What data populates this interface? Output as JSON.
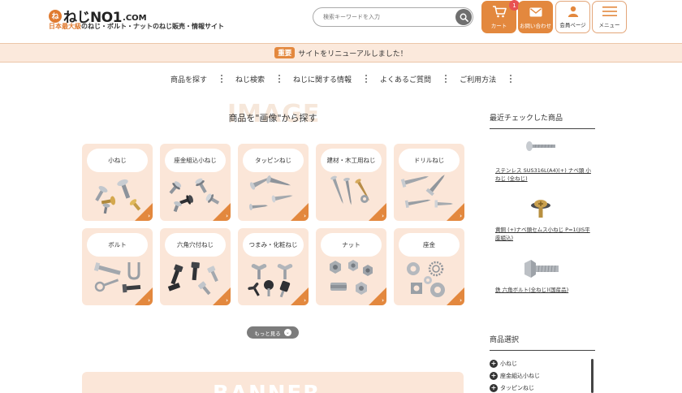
{
  "header": {
    "logo_mark": "ね",
    "logo_text": "ねじNO1",
    "logo_com": ".COM",
    "tagline_highlight": "日本最大級",
    "tagline_rest": "のねじ・ボルト・ナットのねじ販売・情報サイト",
    "search_placeholder": "検索キーワードを入力",
    "cart_label": "カート",
    "cart_count": "1",
    "contact_label": "お問い合わせ",
    "member_label": "会員ページ",
    "menu_label": "メニュー"
  },
  "notice": {
    "tag": "重要",
    "text": "サイトをリニューアルしました！"
  },
  "nav": {
    "items": [
      "商品を探す",
      "ねじ検索",
      "ねじに関する情報",
      "よくあるご質問",
      "ご利用方法"
    ]
  },
  "main": {
    "watermark": "IMAGE",
    "title": "商品を\"画像\"から探す",
    "categories": [
      "小ねじ",
      "座金組込小ねじ",
      "タッピンねじ",
      "建材・木工用ねじ",
      "ドリルねじ",
      "ボルト",
      "六角穴付ねじ",
      "つまみ・化粧ねじ",
      "ナット",
      "座金"
    ],
    "more_label": "もっと見る",
    "banner_watermark": "BANNER"
  },
  "sidebar": {
    "recent_title": "最近チェックした商品",
    "recent_items": [
      "ステンレス SUS316L(A4)(+) ナベ頭 小ねじ (全ねじ)",
      "黄銅 (+)ナベ頭セムス小ねじ P=1(JIS平座組込)",
      "鉄 六角ボルト(全ねじ)(国産品)"
    ],
    "select_title": "商品選択",
    "select_items": [
      "小ねじ",
      "座金組込小ねじ",
      "タッピンねじ"
    ]
  },
  "colors": {
    "accent": "#e3883e",
    "card_bg": "#fbe6d8",
    "notice_bg": "#fbe9dc"
  }
}
